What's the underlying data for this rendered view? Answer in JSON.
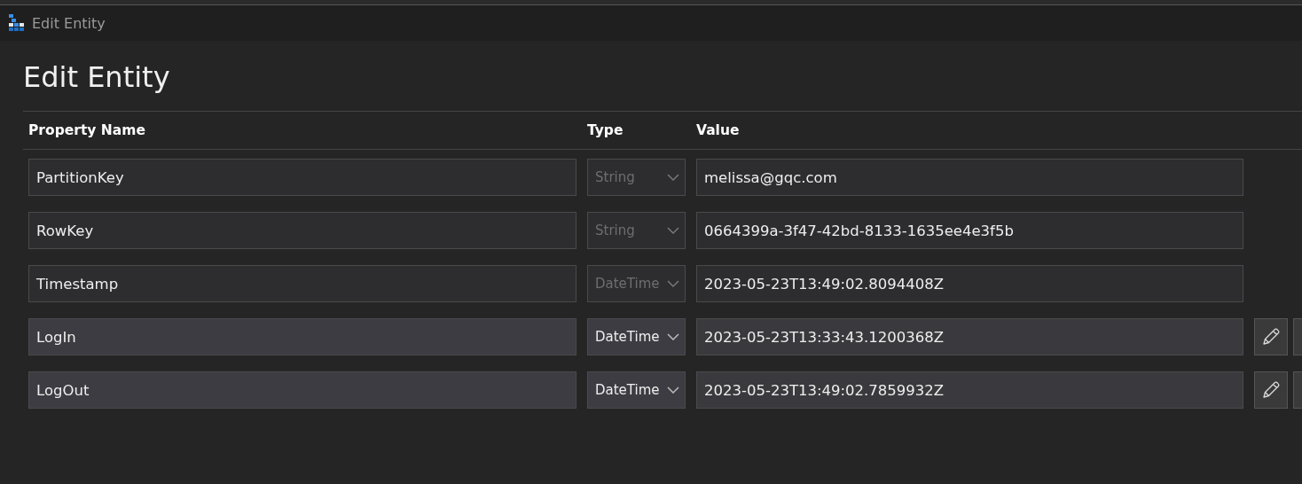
{
  "window": {
    "title": "Edit Entity"
  },
  "heading": "Edit Entity",
  "columns": [
    "Property Name",
    "Type",
    "Value"
  ],
  "rows": [
    {
      "name": "PartitionKey",
      "type": "String",
      "value": "melissa@gqc.com",
      "editable": false
    },
    {
      "name": "RowKey",
      "type": "String",
      "value": "0664399a-3f47-42bd-8133-1635ee4e3f5b",
      "editable": false
    },
    {
      "name": "Timestamp",
      "type": "DateTime",
      "value": "2023-05-23T13:49:02.8094408Z",
      "editable": false
    },
    {
      "name": "LogIn",
      "type": "DateTime",
      "value": "2023-05-23T13:33:43.1200368Z",
      "editable": true
    },
    {
      "name": "LogOut",
      "type": "DateTime",
      "value": "2023-05-23T13:49:02.7859932Z",
      "editable": true
    }
  ]
}
